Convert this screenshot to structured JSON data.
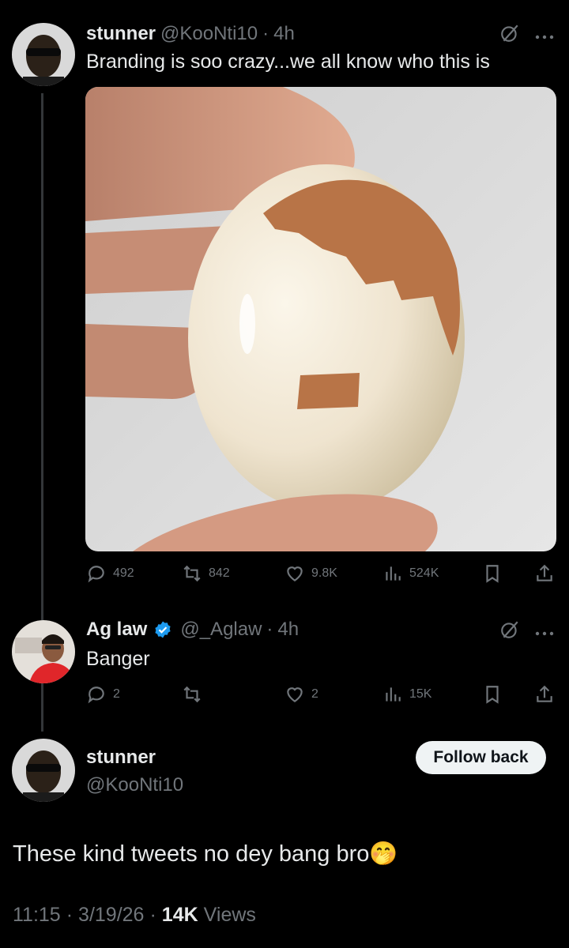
{
  "tweet1": {
    "name": "stunner",
    "handle": "@KooNti10",
    "time_sep": "·",
    "time": "4h",
    "text": "Branding is soo crazy...we all know who this is",
    "replies": "492",
    "reposts": "842",
    "likes": "9.8K",
    "views": "524K"
  },
  "tweet2": {
    "name": "Ag law",
    "handle": "@_Aglaw",
    "time_sep": "·",
    "time": "4h",
    "text": "Banger",
    "replies": "2",
    "likes": "2",
    "views": "15K"
  },
  "main": {
    "name": "stunner",
    "handle": "@KooNti10",
    "follow_label": "Follow back",
    "text": "These kind tweets no dey bang bro",
    "emoji": "🤭",
    "time": "11:15",
    "sep1": "·",
    "date": "3/19/26",
    "sep2": "·",
    "views_count": "14K",
    "views_label": "Views"
  },
  "colors": {
    "background": "#000000",
    "text": "#e7e9ea",
    "muted": "#71767b",
    "verified": "#1d9bf0"
  },
  "icons": [
    "grok-icon",
    "more-icon",
    "reply-icon",
    "repost-icon",
    "like-icon",
    "views-icon",
    "bookmark-icon",
    "share-icon",
    "verified-badge-icon"
  ]
}
